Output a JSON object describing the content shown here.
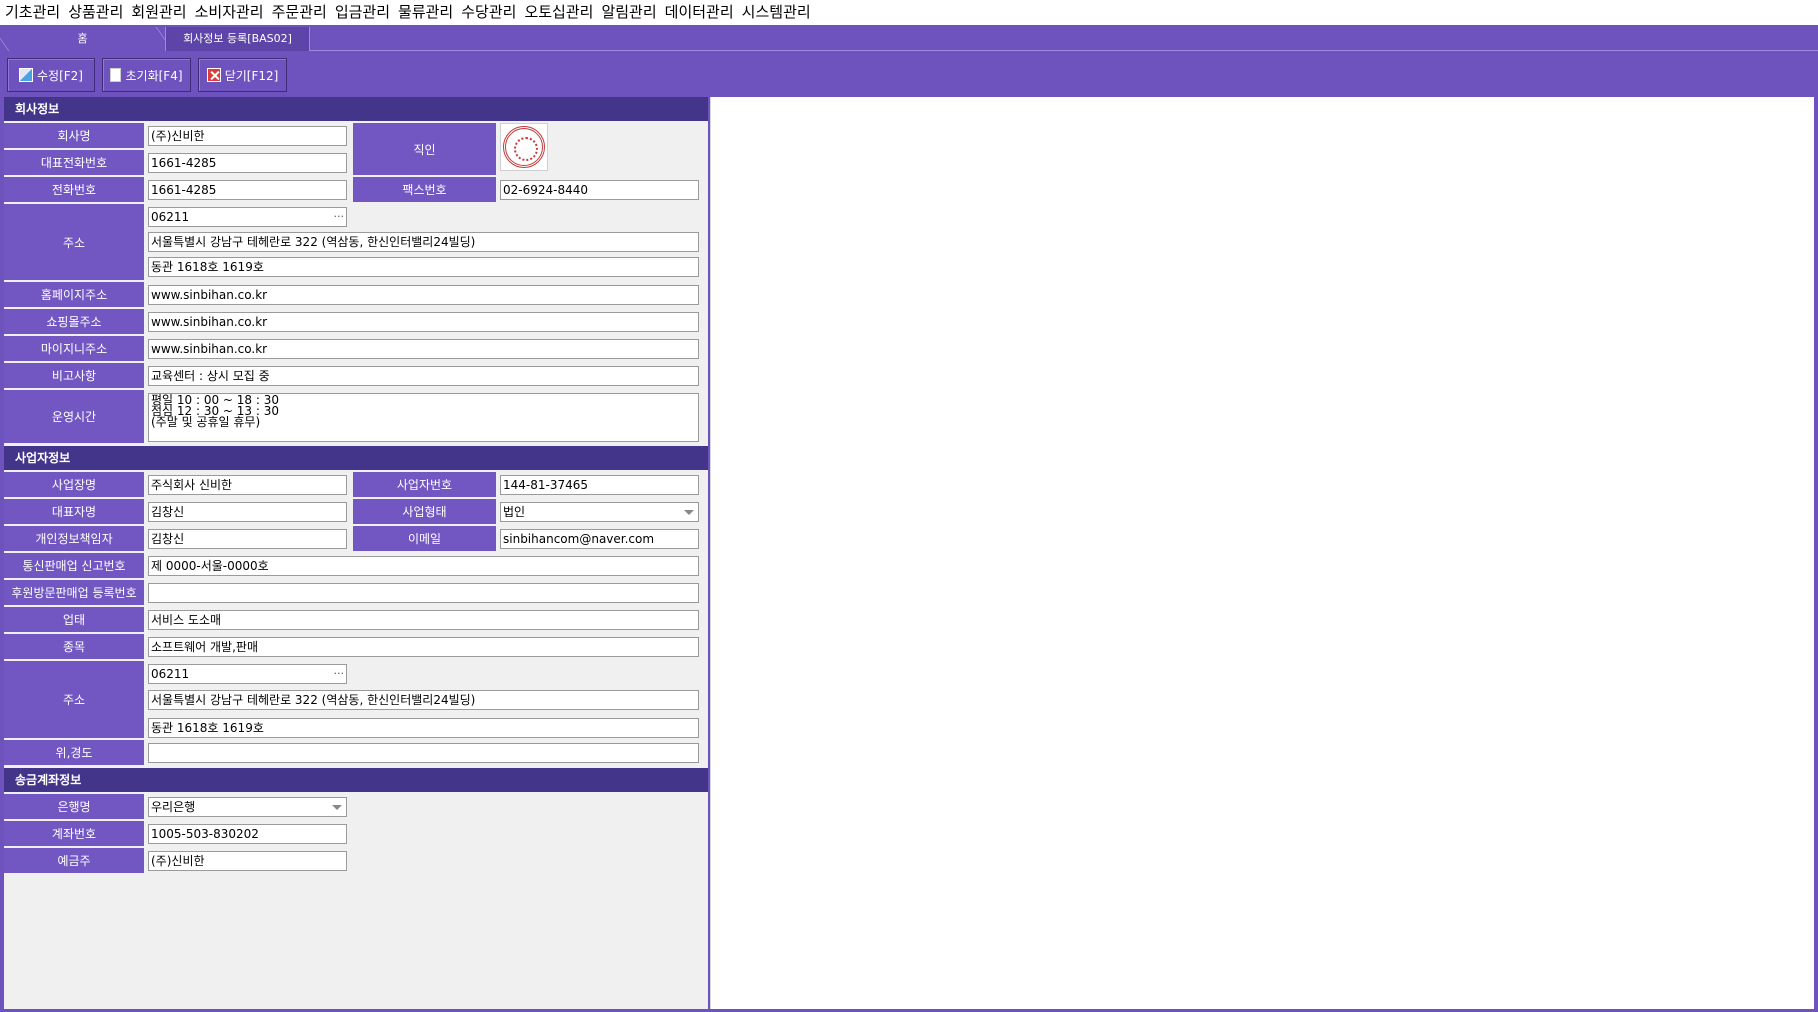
{
  "menu": [
    "기초관리",
    "상품관리",
    "회원관리",
    "소비자관리",
    "주문관리",
    "입금관리",
    "물류관리",
    "수당관리",
    "오토십관리",
    "알림관리",
    "데이터관리",
    "시스템관리"
  ],
  "tabs": {
    "home": "홈",
    "active": "회사정보 등록[BAS02]"
  },
  "toolbar": {
    "edit": "수정[F2]",
    "reset": "초기화[F4]",
    "close": "닫기[F12]"
  },
  "company": {
    "section": "회사정보",
    "name_label": "회사명",
    "name": "(주)신비한",
    "seal_label": "직인",
    "rep_phone_label": "대표전화번호",
    "rep_phone": "1661-4285",
    "phone_label": "전화번호",
    "phone": "1661-4285",
    "fax_label": "팩스번호",
    "fax": "02-6924-8440",
    "address_label": "주소",
    "zip": "06211",
    "addr1": "서울특별시 강남구 테헤란로 322 (역삼동, 한신인터밸리24빌딩)",
    "addr2": "동관 1618호 1619호",
    "homepage_label": "홈페이지주소",
    "homepage": "www.sinbihan.co.kr",
    "mall_label": "쇼핑몰주소",
    "mall": "www.sinbihan.co.kr",
    "mypage_label": "마이지니주소",
    "mypage": "www.sinbihan.co.kr",
    "note_label": "비고사항",
    "note": "교육센터 : 상시 모집 중",
    "hours_label": "운영시간",
    "hours": "평일 10 : 00 ~ 18 : 30\n점심 12 : 30 ~ 13 : 30\n(주말 및 공휴일 휴무)"
  },
  "business": {
    "section": "사업자정보",
    "trade_name_label": "사업장명",
    "trade_name": "주식회사 신비한",
    "biz_no_label": "사업자번호",
    "biz_no": "144-81-37465",
    "ceo_label": "대표자명",
    "ceo": "김창신",
    "biz_type_label": "사업형태",
    "biz_type": "법인",
    "privacy_label": "개인정보책임자",
    "privacy": "김창신",
    "email_label": "이메일",
    "email": "sinbihancom@naver.com",
    "telesales_label": "통신판매업 신고번호",
    "telesales": "제 0000-서울-0000호",
    "visit_label": "후원방문판매업 등록번호",
    "visit": "",
    "category_label": "업태",
    "category": "서비스 도소매",
    "item_label": "종목",
    "item": "소프트웨어 개발,판매",
    "address_label": "주소",
    "zip": "06211",
    "addr1": "서울특별시 강남구 테헤란로 322 (역삼동, 한신인터밸리24빌딩)",
    "addr2": "동관 1618호 1619호",
    "geo_label": "위,경도",
    "geo": ""
  },
  "account": {
    "section": "송금계좌정보",
    "bank_label": "은행명",
    "bank": "우리은행",
    "acct_label": "계좌번호",
    "acct": "1005-503-830202",
    "holder_label": "예금주",
    "holder": "(주)신비한"
  }
}
